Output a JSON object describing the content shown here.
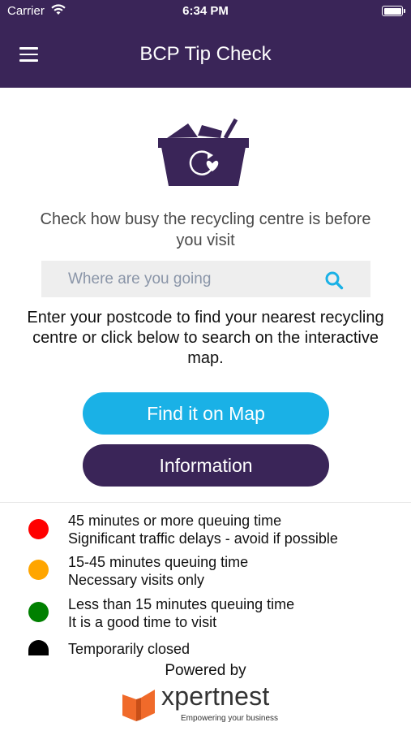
{
  "status_bar": {
    "carrier": "Carrier",
    "time": "6:34 PM"
  },
  "nav": {
    "title": "BCP Tip Check",
    "menu_icon": "hamburger-menu-icon"
  },
  "hero": {
    "icon": "recycling-basket-icon"
  },
  "tagline": "Check how busy the recycling centre is before you visit",
  "search": {
    "placeholder": "Where are you going",
    "value": "",
    "icon": "search-icon"
  },
  "instructions": "Enter your postcode to find your nearest recycling centre or click below to search on the interactive map.",
  "buttons": {
    "map_label": "Find it on Map",
    "map_color": "#1ab1e6",
    "info_label": "Information",
    "info_color": "#3a2558"
  },
  "legend": [
    {
      "color": "#ff0000",
      "line1": "45 minutes or more queuing time",
      "line2": "Significant traffic delays - avoid if possible"
    },
    {
      "color": "#ffa500",
      "line1": "15-45 minutes queuing time",
      "line2": "Necessary visits only"
    },
    {
      "color": "#008000",
      "line1": "Less than 15 minutes queuing time",
      "line2": "It is a good time to visit"
    },
    {
      "color": "#000000",
      "line1": "Temporarily closed",
      "line2": ""
    }
  ],
  "footer": {
    "powered_by": "Powered by",
    "brand_name": "xpertnest",
    "brand_tagline": "Empowering your business"
  },
  "colors": {
    "brand_purple": "#3a2558",
    "accent_blue": "#1ab1e6",
    "logo_orange": "#f06a2a"
  }
}
